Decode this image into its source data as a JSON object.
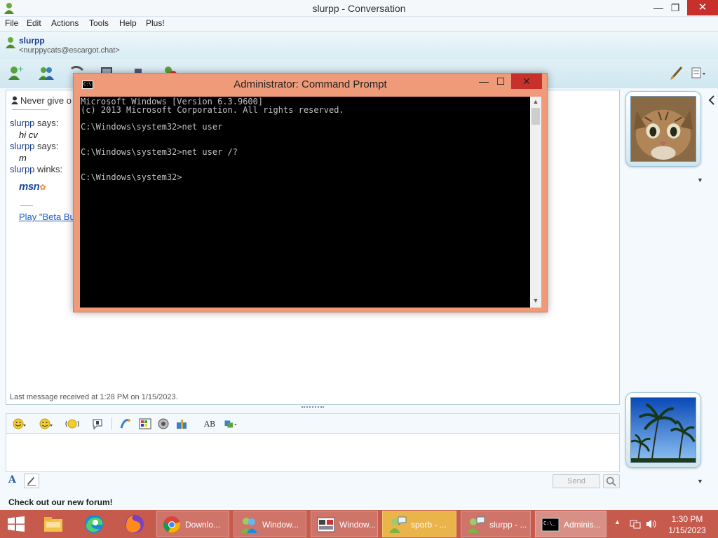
{
  "window": {
    "title": "slurpp - Conversation",
    "minimize": "—",
    "maximize": "❐",
    "close": "✕"
  },
  "menu": [
    "File",
    "Edit",
    "Actions",
    "Tools",
    "Help",
    "Plus!"
  ],
  "contact": {
    "name": "slurpp",
    "email": "<nurppycats@escargot.chat>"
  },
  "conversation": {
    "notice": "Never give o",
    "messages": [
      {
        "sender": "slurpp",
        "verb": "says:",
        "text": "hi cv"
      },
      {
        "sender": "slurpp",
        "verb": "says:",
        "text": "m"
      },
      {
        "sender": "slurpp",
        "verb": "winks:",
        "text": ""
      }
    ],
    "wink_logo": "msn",
    "wink_link": "Play \"Beta Bu",
    "last_message": "Last message received at 1:28 PM on 1/15/2023."
  },
  "input": {
    "send_label": "Send",
    "footer_text": "Check out our new forum!"
  },
  "cmd": {
    "title": "Administrator:  Command Prompt",
    "minimize": "—",
    "maximize": "☐",
    "close": "✕",
    "output": "Microsoft Windows [Version 6.3.9600]\n(c) 2013 Microsoft Corporation. All rights reserved.\n\nC:\\Windows\\system32>net user\n\n\nC:\\Windows\\system32>net user /?\n\n\nC:\\Windows\\system32>"
  },
  "taskbar": {
    "buttons": [
      {
        "label": "Downlo...",
        "icon": "chrome-icon"
      },
      {
        "label": "Window...",
        "icon": "msn-contacts-icon"
      },
      {
        "label": "Window...",
        "icon": "window-preview-icon"
      },
      {
        "label": "sporb - ...",
        "icon": "msn-buddy-icon"
      },
      {
        "label": "slurpp - ...",
        "icon": "msn-buddy-icon"
      },
      {
        "label": "Adminis...",
        "icon": "cmd-icon"
      }
    ],
    "time": "1:30 PM",
    "date": "1/15/2023"
  },
  "colors": {
    "accent": "#1b3d8a",
    "taskbar": "#c65a4d",
    "cmd_frame": "#ef9b79"
  }
}
